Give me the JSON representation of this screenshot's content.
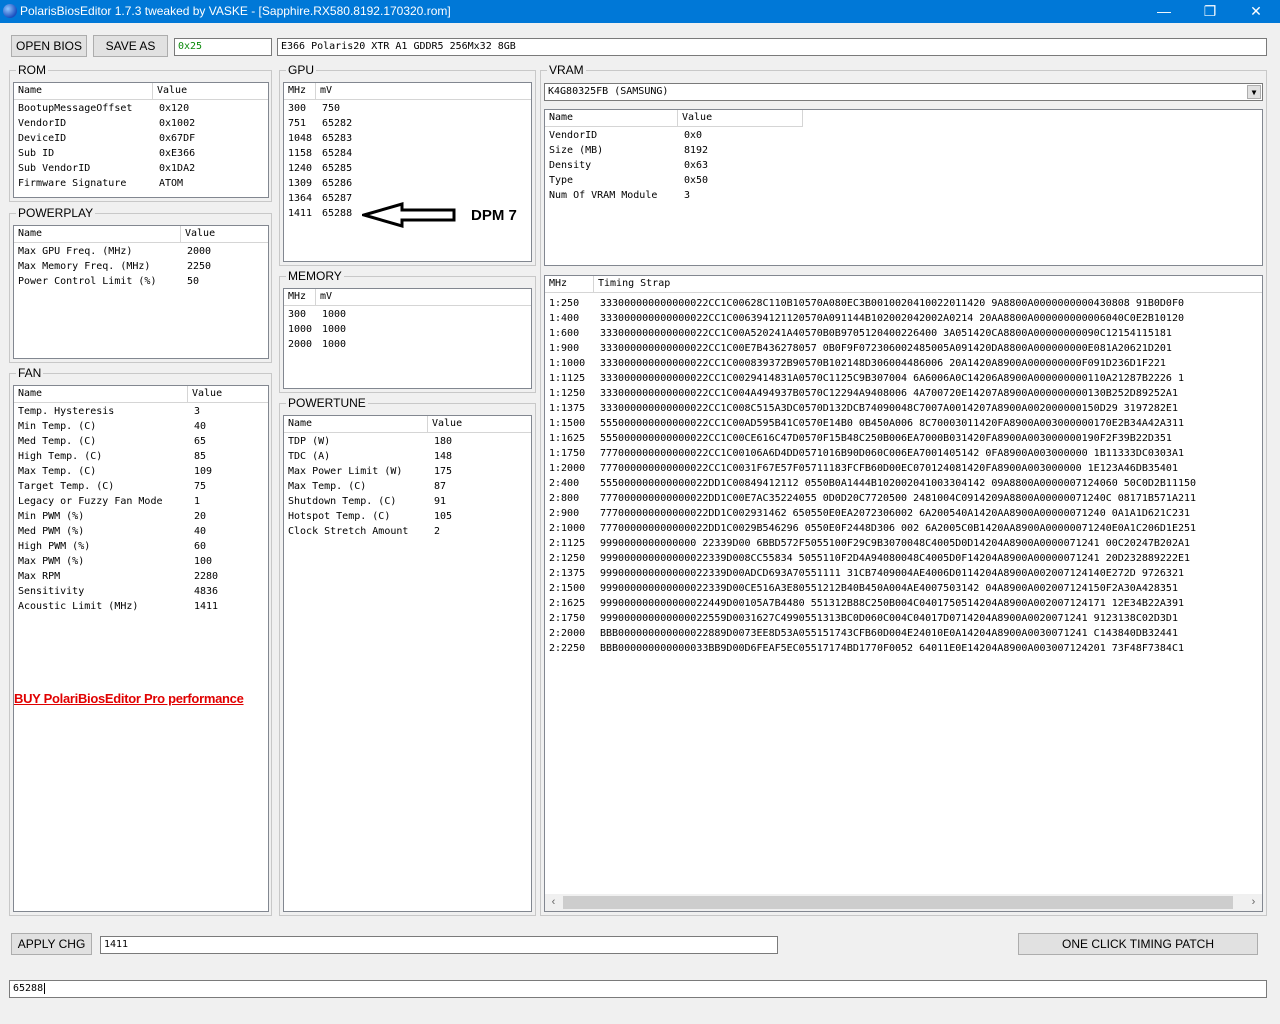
{
  "window": {
    "title": "PolarisBiosEditor 1.7.3 tweaked by VASKE - [Sapphire.RX580.8192.170320.rom]",
    "minimize_glyph": "—",
    "maximize_glyph": "❐",
    "close_glyph": "✕"
  },
  "toolbar": {
    "open_label": "OPEN BIOS",
    "save_label": "SAVE AS",
    "hex_value": "0x25",
    "bios_info": "E366 Polaris20 XTR A1 GDDR5 256Mx32 8GB"
  },
  "rom": {
    "label": "ROM",
    "headers": [
      "Name",
      "Value"
    ],
    "rows": [
      [
        "BootupMessageOffset",
        "0x120"
      ],
      [
        "VendorID",
        "0x1002"
      ],
      [
        "DeviceID",
        "0x67DF"
      ],
      [
        "Sub ID",
        "0xE366"
      ],
      [
        "Sub VendorID",
        "0x1DA2"
      ],
      [
        "Firmware Signature",
        "ATOM"
      ]
    ]
  },
  "powerplay": {
    "label": "POWERPLAY",
    "headers": [
      "Name",
      "Value"
    ],
    "rows": [
      [
        "Max GPU Freq. (MHz)",
        "2000"
      ],
      [
        "Max Memory Freq. (MHz)",
        "2250"
      ],
      [
        "Power Control Limit (%)",
        "50"
      ]
    ]
  },
  "fan": {
    "label": "FAN",
    "headers": [
      "Name",
      "Value"
    ],
    "rows": [
      [
        "Temp. Hysteresis",
        "3"
      ],
      [
        "Min Temp. (C)",
        "40"
      ],
      [
        "Med Temp. (C)",
        "65"
      ],
      [
        "High Temp. (C)",
        "85"
      ],
      [
        "Max Temp. (C)",
        "109"
      ],
      [
        "Target Temp. (C)",
        "75"
      ],
      [
        "Legacy or Fuzzy Fan Mode",
        "1"
      ],
      [
        "Min PWM (%)",
        "20"
      ],
      [
        "Med PWM (%)",
        "40"
      ],
      [
        "High PWM (%)",
        "60"
      ],
      [
        "Max PWM (%)",
        "100"
      ],
      [
        "Max RPM",
        "2280"
      ],
      [
        "Sensitivity",
        "4836"
      ],
      [
        "Acoustic Limit (MHz)",
        "1411"
      ]
    ],
    "buy_link": "BUY PolariBiosEditor Pro performance"
  },
  "gpu": {
    "label": "GPU",
    "headers": [
      "MHz",
      "mV"
    ],
    "rows": [
      [
        "300",
        "750"
      ],
      [
        "751",
        "65282"
      ],
      [
        "1048",
        "65283"
      ],
      [
        "1158",
        "65284"
      ],
      [
        "1240",
        "65285"
      ],
      [
        "1309",
        "65286"
      ],
      [
        "1364",
        "65287"
      ],
      [
        "1411",
        "65288"
      ]
    ],
    "annotation": "DPM 7"
  },
  "memory": {
    "label": "MEMORY",
    "headers": [
      "MHz",
      "mV"
    ],
    "rows": [
      [
        "300",
        "1000"
      ],
      [
        "1000",
        "1000"
      ],
      [
        "2000",
        "1000"
      ]
    ]
  },
  "powertune": {
    "label": "POWERTUNE",
    "headers": [
      "Name",
      "Value"
    ],
    "rows": [
      [
        "TDP (W)",
        "180"
      ],
      [
        "TDC (A)",
        "148"
      ],
      [
        "Max Power Limit (W)",
        "175"
      ],
      [
        "Max Temp. (C)",
        "87"
      ],
      [
        "Shutdown Temp. (C)",
        "91"
      ],
      [
        "Hotspot Temp. (C)",
        "105"
      ],
      [
        "Clock Stretch Amount",
        "2"
      ]
    ]
  },
  "vram": {
    "label": "VRAM",
    "selected_module": "K4G80325FB (SAMSUNG)",
    "headers": [
      "Name",
      "Value"
    ],
    "rows": [
      [
        "VendorID",
        "0x0"
      ],
      [
        "Size (MB)",
        "8192"
      ],
      [
        "Density",
        "0x63"
      ],
      [
        "Type",
        "0x50"
      ],
      [
        "Num Of VRAM Module",
        "3"
      ]
    ]
  },
  "timings": {
    "headers": [
      "MHz",
      "Timing Strap"
    ],
    "rows": [
      [
        "1:250",
        "333000000000000022CC1C00628C110B10570A080EC3B0010020410022011420 9A8800A0000000000430808 91B0D0F0"
      ],
      [
        "1:400",
        "333000000000000022CC1C006394121120570A091144B102002042002A0214 20AA8800A000000000006040C0E2B10120"
      ],
      [
        "1:600",
        "333000000000000022CC1C00A520241A40570B0B9705120400226400 3A051420CA8800A00000000090C12154115181"
      ],
      [
        "1:900",
        "333000000000000022CC1C00E7B436278057 0B0F9F072306002485005A091420DA8800A000000000E081A20621D201"
      ],
      [
        "1:1000",
        "333000000000000022CC1C000839372B90570B102148D306004486006 20A1420A8900A000000000F091D236D1F221"
      ],
      [
        "1:1125",
        "333000000000000022CC1C0029414831A0570C1125C9B307004 6A6006A0C14206A8900A000000000110A21287B2226 1"
      ],
      [
        "1:1250",
        "333000000000000022CC1C004A494937B0570C12294A9408006 4A700720E14207A8900A000000000130B252D89252A1"
      ],
      [
        "1:1375",
        "333000000000000022CC1C008C515A3DC0570D132DCB74090048C7007A0014207A8900A002000000150D29 3197282E1"
      ],
      [
        "1:1500",
        "555000000000000022CC1C00AD595B41C0570E14B0 0B450A006 8C70003011420FA8900A003000000170E2B34A42A311"
      ],
      [
        "1:1625",
        "555000000000000022CC1C00CE616C47D0570F15B48C250B006EA7000B031420FA8900A003000000190F2F39B22D351"
      ],
      [
        "1:1750",
        "777000000000000022CC1C00106A6D4DD0571016B90D060C006EA7001405142 0FA8900A003000000 1B11333DC0303A1"
      ],
      [
        "1:2000",
        "777000000000000022CC1C0031F67E57F05711183FCFB60D00EC070124081420FA8900A003000000 1E123A46DB35401"
      ],
      [
        "2:400",
        "555000000000000022DD1C00849412112 0550B0A1444B102002041003304142 09A8800A0000007124060 50C0D2B11150"
      ],
      [
        "2:800",
        "777000000000000022DD1C00E7AC35224055 0D0D20C7720500 2481004C0914209A8800A00000071240C 08171B571A211"
      ],
      [
        "2:900",
        "777000000000000022DD1C002931462 650550E0EA2072306002 6A200540A1420AA8900A00000071240 0A1A1D621C231"
      ],
      [
        "2:1000",
        "777000000000000022DD1C0029B546296 0550E0F2448D306 002 6A2005C0B1420AA8900A00000071240E0A1C206D1E251"
      ],
      [
        "2:1125",
        "9990000000000000 22339D00 6BBD572F5055100F29C9B3070048C4005D0D14204A8900A0000071241 00C20247B202A1"
      ],
      [
        "2:1250",
        "999000000000000022339D008CC55834 5055110F2D4A94080048C4005D0F14204A8900A00000071241 20D232889222E1"
      ],
      [
        "2:1375",
        "999000000000000022339D00ADCD693A70551111 31CB7409004AE4006D0114204A8900A002007124140E272D 9726321"
      ],
      [
        "2:1500",
        "999000000000000022339D00CE516A3E80551212B40B450A004AE4007503142 04A8900A002007124150F2A30A428351"
      ],
      [
        "2:1625",
        "999000000000000022449D00105A7B4480 551312B88C250B004C0401750514204A8900A002007124171 12E34B22A391"
      ],
      [
        "2:1750",
        "999000000000000022559D0031627C4990551313BC0D060C004C04017D0714204A8900A0020071241 9123138C02D3D1"
      ],
      [
        "2:2000",
        "BBB000000000000022889D0073EE8D53A055151743CFB60D004E24010E0A14204A8900A0030071241 C143840DB32441"
      ],
      [
        "2:2250",
        "BBB000000000000033BB9D00D6FEAF5EC05517174BD1770F0052 64011E0E14204A8900A003007124201 73F48F7384C1"
      ]
    ]
  },
  "bottom": {
    "apply_label": "APPLY CHG",
    "edit_value": "1411",
    "timing_patch_label": "ONE CLICK TIMING PATCH",
    "status_value": "65288"
  }
}
